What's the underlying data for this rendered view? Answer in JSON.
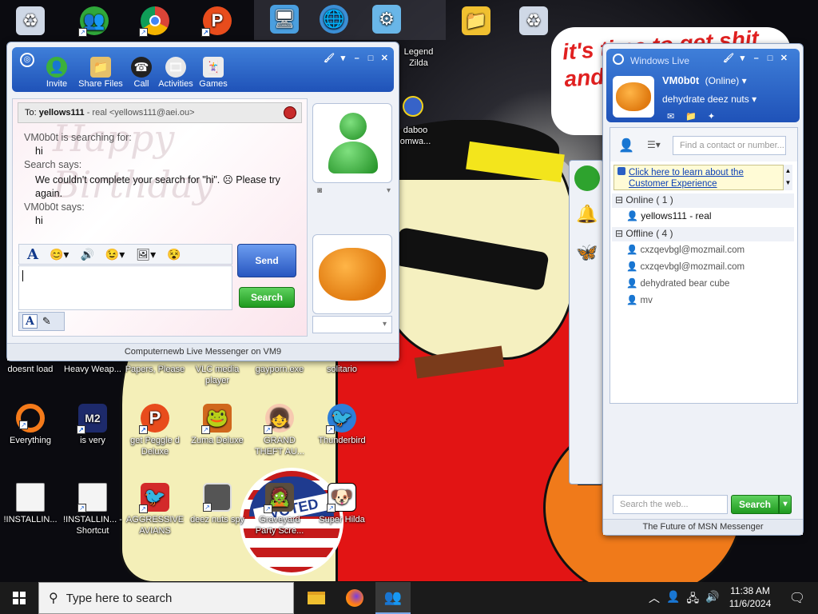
{
  "wallpaper": {
    "speech_text": "it's time to get shit and... or t",
    "badge_text": "VOTED"
  },
  "desktop_icons": [
    {
      "label": "",
      "icon": "recycle-bin-icon"
    },
    {
      "label": "",
      "icon": "messenger-icon"
    },
    {
      "label": "",
      "icon": "chrome-icon"
    },
    {
      "label": "",
      "icon": "peggle-icon"
    },
    {
      "label": "",
      "icon": "computer-icon"
    },
    {
      "label": "",
      "icon": "network-icon"
    },
    {
      "label": "",
      "icon": "control-panel-icon"
    },
    {
      "label": "",
      "icon": "file-explorer-icon"
    },
    {
      "label": "",
      "icon": "recycle-bin-icon"
    },
    {
      "label": "Legend Zilda",
      "icon": "game-icon"
    },
    {
      "label": "daboo omwa...",
      "icon": "app-icon"
    },
    {
      "label": "doesnt load",
      "icon": "file-icon"
    },
    {
      "label": "Heavy Weap...",
      "icon": "game-icon"
    },
    {
      "label": "Papers, Please",
      "icon": "game-icon"
    },
    {
      "label": "VLC media player",
      "icon": "vlc-icon"
    },
    {
      "label": "gayporn.exe",
      "icon": "exe-icon"
    },
    {
      "label": "solitario",
      "icon": "cards-icon"
    },
    {
      "label": "Everything",
      "icon": "search-icon"
    },
    {
      "label": "is very",
      "icon": "game-icon"
    },
    {
      "label": "get Peggle d Deluxe",
      "icon": "peggle-icon"
    },
    {
      "label": "Zuma Deluxe",
      "icon": "zuma-icon"
    },
    {
      "label": "GRAND THEFT AU...",
      "icon": "game-icon"
    },
    {
      "label": "Thunderbird",
      "icon": "thunderbird-icon"
    },
    {
      "label": "!INSTALLIN...",
      "icon": "document-icon"
    },
    {
      "label": "!INSTALLIN... - Shortcut",
      "icon": "document-icon"
    },
    {
      "label": "AGGRESSIVE AVIANS",
      "icon": "angry-birds-icon"
    },
    {
      "label": "deez nuts spy",
      "icon": "app-icon"
    },
    {
      "label": "Graveyard Party Scre...",
      "icon": "game-icon"
    },
    {
      "label": "Super Hilda",
      "icon": "game-icon"
    }
  ],
  "chat": {
    "toolbar": [
      {
        "label": "Invite",
        "icon": "invite-icon"
      },
      {
        "label": "Share Files",
        "icon": "share-files-icon"
      },
      {
        "label": "Call",
        "icon": "phone-icon"
      },
      {
        "label": "Activities",
        "icon": "activities-icon"
      },
      {
        "label": "Games",
        "icon": "games-icon"
      }
    ],
    "to_label": "To:",
    "to_name": "yellows111",
    "to_rest": " - real <yellows111@aei.ou>",
    "background_text": "Happy Birthday",
    "messages": [
      {
        "sender": "VM0b0t is searching for:",
        "text": "hi"
      },
      {
        "sender": "Search says:",
        "text": "We couldn't complete your search for \"hi\". ☹ Please try again."
      },
      {
        "sender": "VM0b0t says:",
        "text": "hi"
      }
    ],
    "send_label": "Send",
    "search_label": "Search",
    "input_value": "",
    "footer": "Computernewb Live Messenger on VM9",
    "font_glyph": "A"
  },
  "contacts": {
    "window_title": "Windows Live",
    "username": "VM0b0t",
    "status": "(Online)",
    "personal_message": "dehydrate deez nuts",
    "search_placeholder": "Find a contact or number...",
    "banner_line1": "Click here to learn about the",
    "banner_line2": "Customer Experience",
    "online_header": "Online ( 1 )",
    "online": [
      "yellows111 - real"
    ],
    "offline_header": "Offline ( 4 )",
    "offline": [
      "cxzqevbgl@mozmail.com",
      "cxzqevbgl@mozmail.com",
      "dehydrated bear cube",
      "mv"
    ],
    "web_search_placeholder": "Search the web...",
    "web_search_button": "Search",
    "footer": "The Future of MSN Messenger"
  },
  "taskbar": {
    "search_placeholder": "Type here to search",
    "time": "11:38 AM",
    "date": "11/6/2024"
  },
  "colors": {
    "accent": "#2a5fc4",
    "green": "#2aa52a",
    "link": "#0b3fb5",
    "taskbar": "#1b1b1b"
  }
}
